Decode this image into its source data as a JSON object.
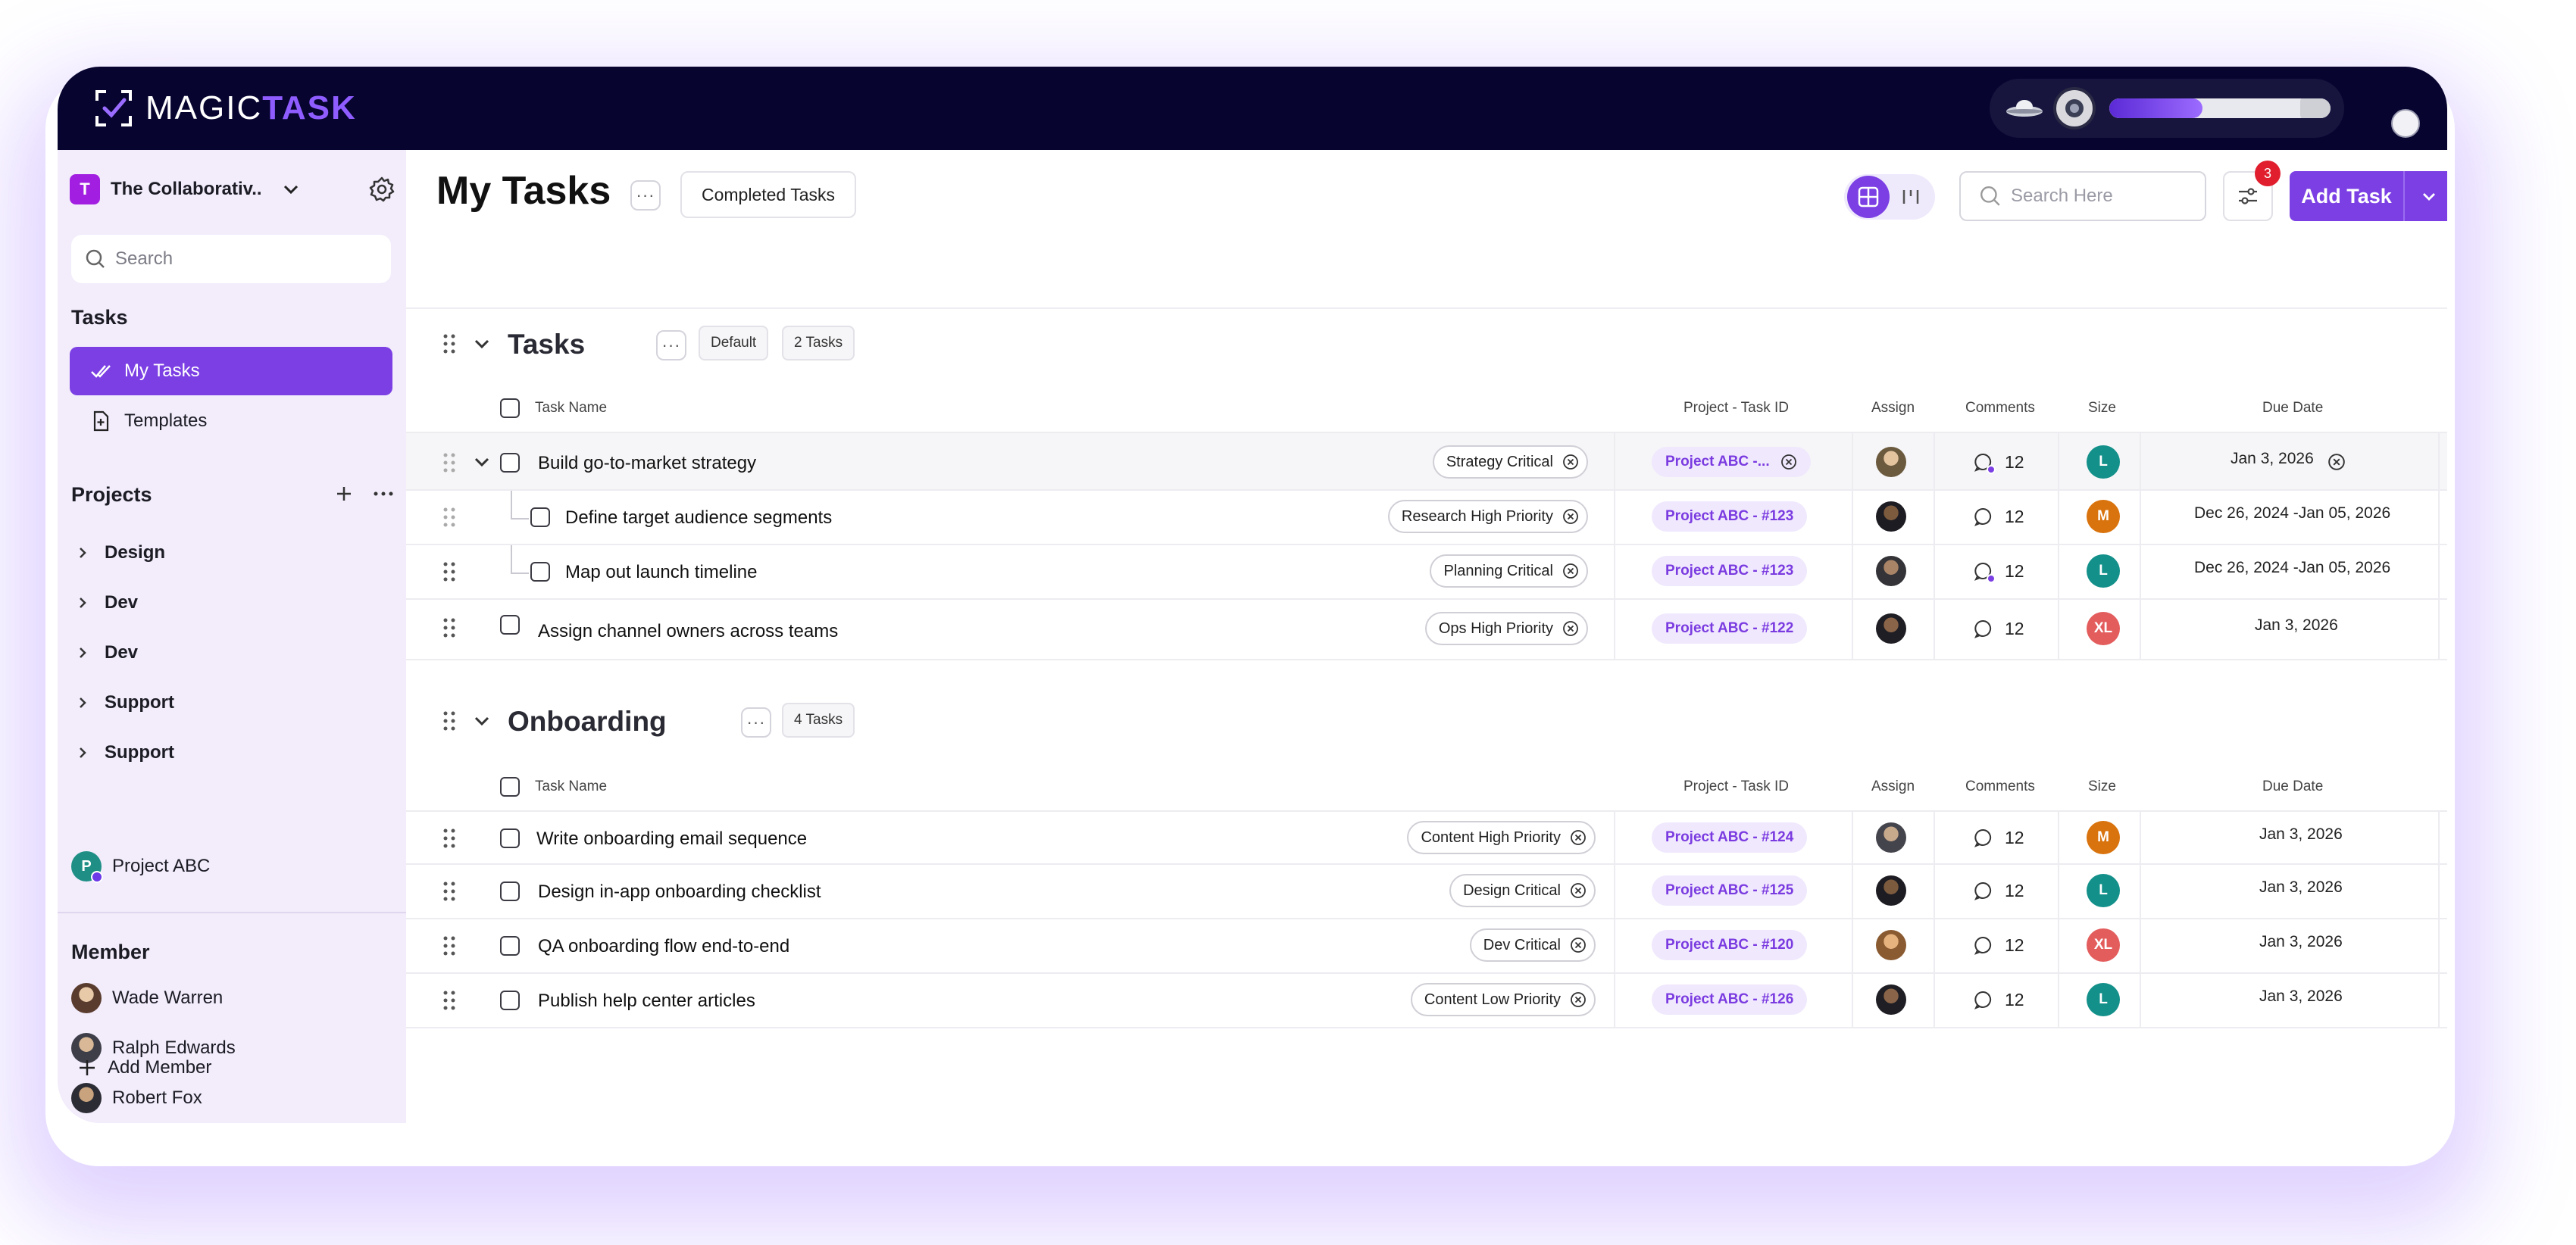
{
  "brand": {
    "logo_plain": "MAGIC",
    "logo_accent": "TASK"
  },
  "colors": {
    "accent": "#7b3fe4",
    "topbar": "#070530",
    "sidebar": "#f2ecfb"
  },
  "top_widget": {
    "progress_percent": 42
  },
  "workspace": {
    "initial": "T",
    "name": "The Collaborativ..."
  },
  "sidebar": {
    "search_placeholder": "Search",
    "tasks_title": "Tasks",
    "nav": [
      {
        "label": "My Tasks",
        "icon": "double-check-icon"
      },
      {
        "label": "Templates",
        "icon": "file-plus-icon"
      }
    ],
    "projects_title": "Projects",
    "projects": [
      "Design",
      "Dev",
      "Dev",
      "Support",
      "Support"
    ],
    "project_abc": {
      "initial": "P",
      "label": "Project ABC"
    },
    "member_title": "Member",
    "members": [
      "Wade Warren",
      "Ralph Edwards",
      "Robert Fox"
    ],
    "add_member": "Add Member"
  },
  "header": {
    "title": "My Tasks",
    "more": "···",
    "completed_label": "Completed Tasks",
    "search_placeholder": "Search Here",
    "notification_count": "3",
    "add_task_label": "Add Task"
  },
  "columns": {
    "task_name": "Task Name",
    "project_task_id": "Project - Task ID",
    "assign": "Assign",
    "comments": "Comments",
    "size": "Size",
    "due_date": "Due Date"
  },
  "groups": [
    {
      "title": "Tasks",
      "more": "···",
      "tag": "Default",
      "count": "2 Tasks",
      "rows": [
        {
          "name": "Build go-to-market strategy",
          "priority": "Strategy Critical",
          "pid": "Project ABC -...",
          "comments": "12",
          "size": "L",
          "size_color": "#14908a",
          "due": "Jan 3, 2026"
        },
        {
          "name": "Define target audience segments",
          "priority": "Research High Priority",
          "pid": "Project ABC - #123",
          "comments": "12",
          "size": "M",
          "size_color": "#d9730d",
          "due": "Dec 26, 2024  -Jan 05, 2026"
        },
        {
          "name": "Map out launch timeline",
          "priority": "Planning Critical",
          "pid": "Project ABC - #123",
          "comments": "12",
          "size": "L",
          "size_color": "#14908a",
          "due": "Dec 26, 2024  -Jan 05, 2026"
        },
        {
          "name": "Assign channel owners across teams",
          "priority": "Ops High Priority",
          "pid": "Project ABC - #122",
          "comments": "12",
          "size": "XL",
          "size_color": "#e35d5d",
          "due": "Jan 3, 2026"
        }
      ]
    },
    {
      "title": "Onboarding",
      "more": "···",
      "count": "4 Tasks",
      "rows": [
        {
          "name": "Write onboarding email sequence",
          "priority": "Content High Priority",
          "pid": "Project ABC - #124",
          "comments": "12",
          "size": "M",
          "size_color": "#d9730d",
          "due": "Jan 3, 2026"
        },
        {
          "name": "Design in-app onboarding checklist",
          "priority": "Design Critical",
          "pid": "Project ABC - #125",
          "comments": "12",
          "size": "L",
          "size_color": "#14908a",
          "due": "Jan 3, 2026"
        },
        {
          "name": "QA onboarding flow end-to-end",
          "priority": "Dev Critical",
          "pid": "Project ABC - #120",
          "comments": "12",
          "size": "XL",
          "size_color": "#e35d5d",
          "due": "Jan 3, 2026"
        },
        {
          "name": "Publish help center articles",
          "priority": "Content Low Priority",
          "pid": "Project ABC - #126",
          "comments": "12",
          "size": "L",
          "size_color": "#14908a",
          "due": "Jan 3, 2026"
        }
      ]
    }
  ]
}
